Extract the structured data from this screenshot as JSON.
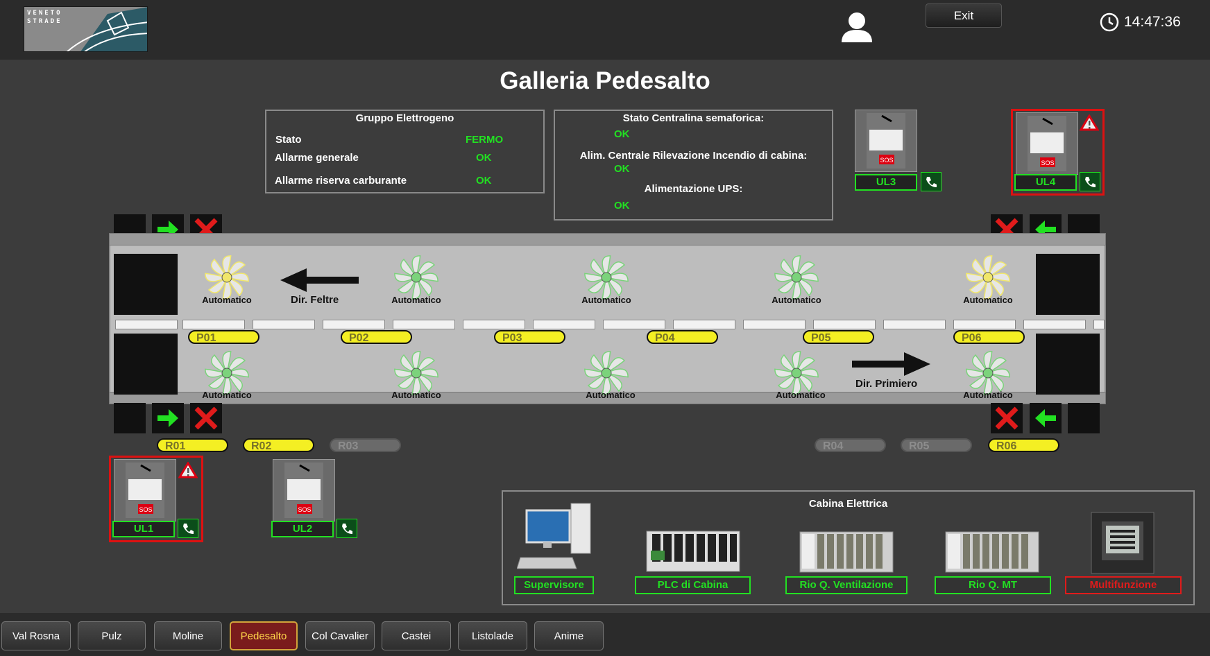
{
  "header": {
    "logo_text_1": "VENETO",
    "logo_text_2": "STRADE",
    "exit_label": "Exit",
    "time": "14:47:36"
  },
  "page_title": "Galleria Pedesalto",
  "generator": {
    "title": "Gruppo Elettrogeno",
    "rows": [
      {
        "label": "Stato",
        "value": "FERMO"
      },
      {
        "label": "Allarme generale",
        "value": "OK"
      },
      {
        "label": "Allarme riserva carburante",
        "value": "OK"
      }
    ]
  },
  "status": {
    "traffic_label": "Stato Centralina semaforica:",
    "traffic_value": "OK",
    "fire_label": "Alim. Centrale Rilevazione Incendio di cabina:",
    "fire_value": "OK",
    "ups_label": "Alimentazione UPS:",
    "ups_value": "OK"
  },
  "tunnel": {
    "fan_label": "Automatico",
    "dir_left": "Dir. Feltre",
    "dir_right": "Dir. Primiero",
    "p_tags": [
      "P01",
      "P02",
      "P03",
      "P04",
      "P05",
      "P06"
    ],
    "r_tags": [
      {
        "label": "R01",
        "active": true
      },
      {
        "label": "R02",
        "active": true
      },
      {
        "label": "R03",
        "active": false
      },
      {
        "label": "R04",
        "active": false
      },
      {
        "label": "R05",
        "active": false
      },
      {
        "label": "R06",
        "active": true
      }
    ]
  },
  "sos": {
    "sos_text": "SOS",
    "units": [
      {
        "label": "UL1",
        "alarm": true
      },
      {
        "label": "UL2",
        "alarm": false
      },
      {
        "label": "UL3",
        "alarm": false
      },
      {
        "label": "UL4",
        "alarm": true
      }
    ]
  },
  "cabina": {
    "title": "Cabina Elettrica",
    "devices": [
      {
        "label": "Supervisore",
        "fault": false
      },
      {
        "label": "PLC di Cabina",
        "fault": false
      },
      {
        "label": "Rio Q. Ventilazione",
        "fault": false
      },
      {
        "label": "Rio Q. MT",
        "fault": false
      },
      {
        "label": "Multifunzione",
        "fault": true
      }
    ]
  },
  "nav": [
    {
      "label": "Val Rosna",
      "active": false
    },
    {
      "label": "Pulz",
      "active": false
    },
    {
      "label": "Moline",
      "active": false
    },
    {
      "label": "Pedesalto",
      "active": true
    },
    {
      "label": "Col Cavalier",
      "active": false
    },
    {
      "label": "Castei",
      "active": false
    },
    {
      "label": "Listolade",
      "active": false
    },
    {
      "label": "Anime",
      "active": false
    }
  ],
  "colors": {
    "ok_green": "#22e022",
    "alarm_red": "#e01b1b",
    "tag_yellow": "#f4ef23",
    "active_nav": "#7a1c1c"
  }
}
